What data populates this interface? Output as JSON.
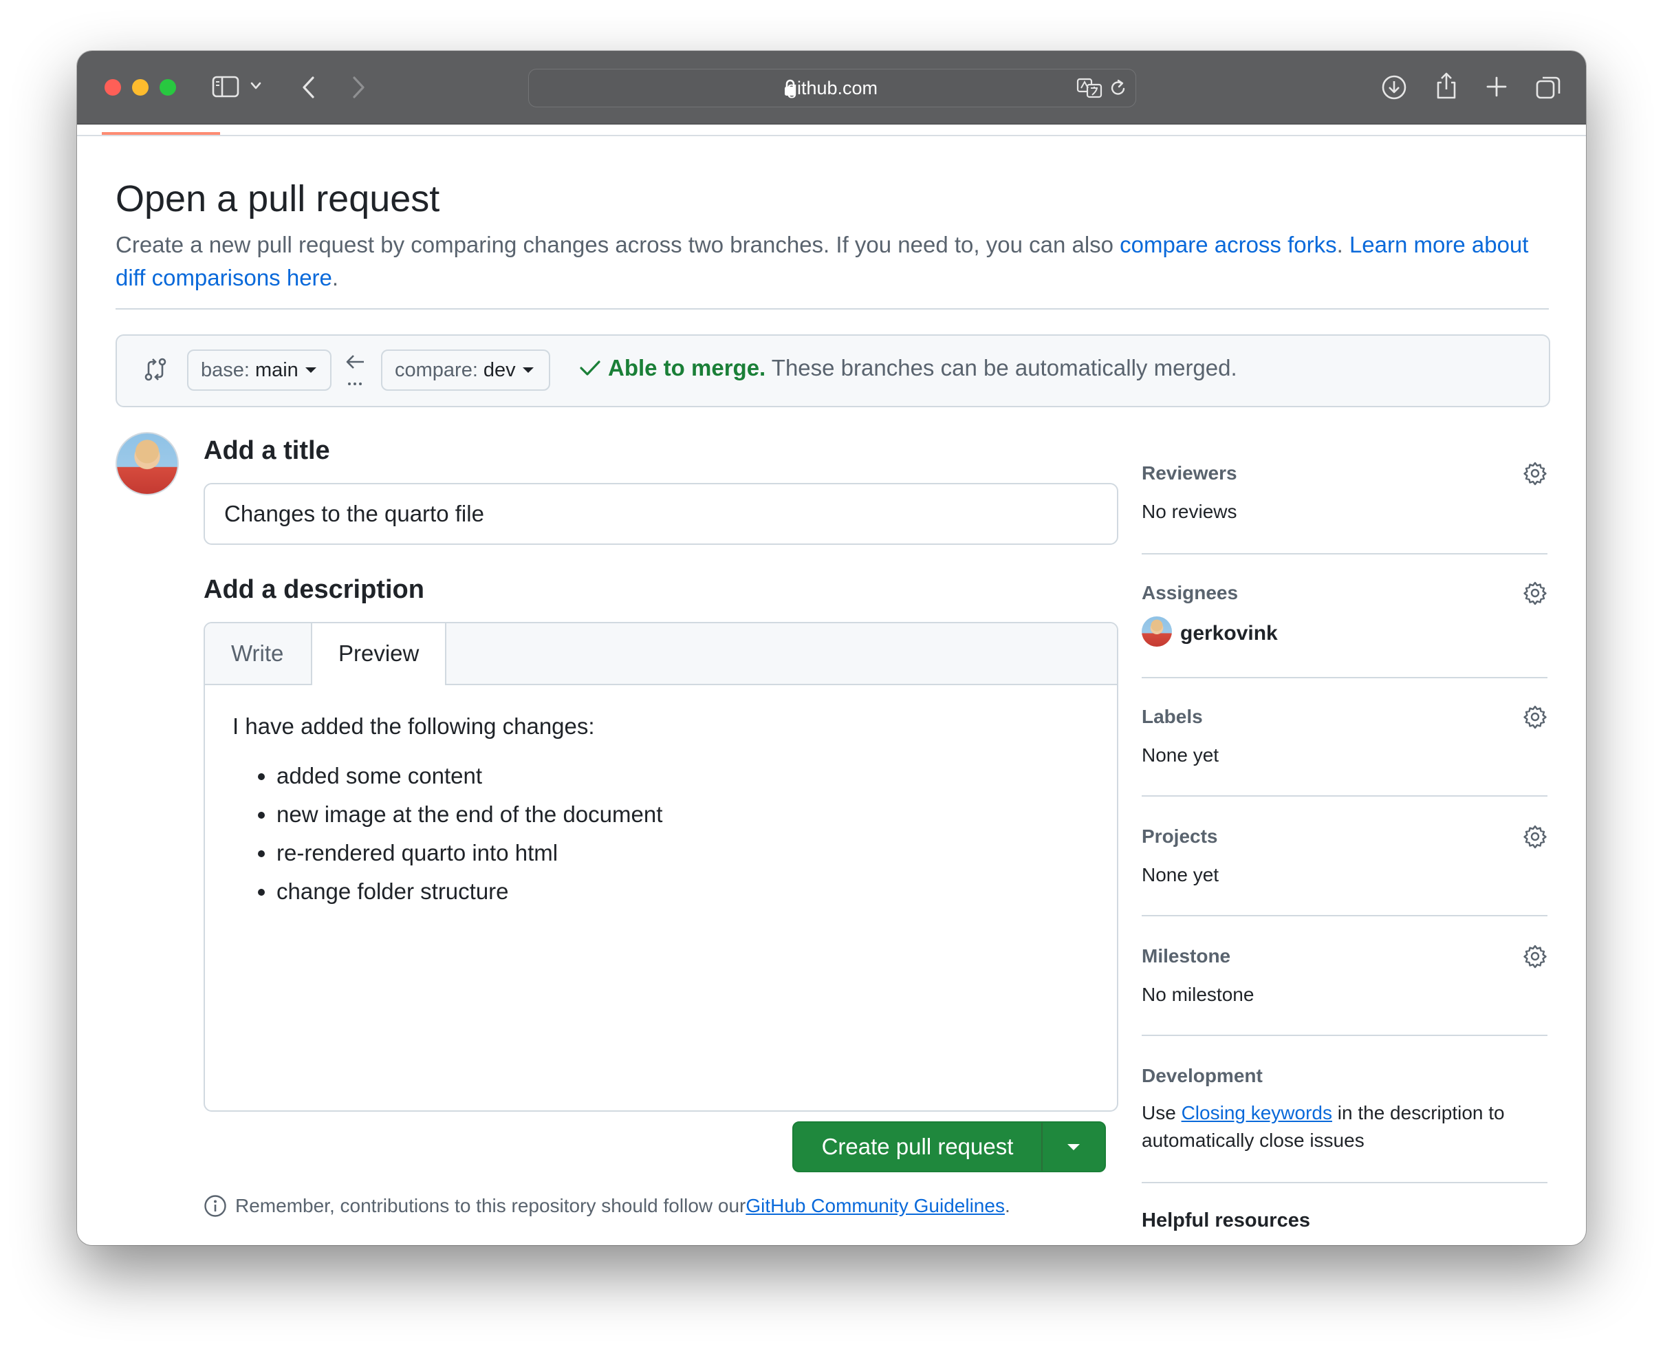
{
  "browser": {
    "url": "github.com",
    "icons": [
      "sidebar-icon",
      "chevron-down-icon",
      "back-icon",
      "forward-icon",
      "lock-icon",
      "translate-icon",
      "reload-icon",
      "download-icon",
      "share-icon",
      "plus-icon",
      "tabs-icon"
    ]
  },
  "page": {
    "title": "Open a pull request",
    "subtitle_prefix": "Create a new pull request by comparing changes across two branches. If you need to, you can also ",
    "compare_forks_link": "compare across forks",
    "subtitle_mid": ". ",
    "learn_more_link": "Learn more about diff comparisons here",
    "subtitle_suffix": "."
  },
  "compare": {
    "base_prefix": "base:",
    "base_branch": "main",
    "compare_prefix": "compare:",
    "compare_branch": "dev",
    "merge_ok": "Able to merge.",
    "merge_text": " These branches can be automatically merged."
  },
  "form": {
    "title_heading": "Add a title",
    "title_value": "Changes to the quarto file",
    "description_heading": "Add a description",
    "tabs": {
      "write": "Write",
      "preview": "Preview"
    },
    "preview": {
      "intro": "I have added the following changes:",
      "items": [
        "added some content",
        "new image at the end of the document",
        "re-rendered quarto into html",
        "change folder structure"
      ]
    },
    "create_button": "Create pull request",
    "note_prefix": "Remember, contributions to this repository should follow our ",
    "note_link": "GitHub Community Guidelines",
    "note_suffix": "."
  },
  "sidebar": {
    "reviewers": {
      "label": "Reviewers",
      "value": "No reviews"
    },
    "assignees": {
      "label": "Assignees",
      "value": "gerkovink"
    },
    "labels": {
      "label": "Labels",
      "value": "None yet"
    },
    "projects": {
      "label": "Projects",
      "value": "None yet"
    },
    "milestone": {
      "label": "Milestone",
      "value": "No milestone"
    },
    "development": {
      "label": "Development",
      "text_prefix": "Use ",
      "link": "Closing keywords",
      "text_suffix": " in the description to automatically close issues"
    },
    "helpful": "Helpful resources"
  },
  "colors": {
    "accent_link": "#0969da",
    "merge_green": "#1a7f37",
    "button_green": "#1f883d",
    "titlebar": "#5d5e60"
  }
}
